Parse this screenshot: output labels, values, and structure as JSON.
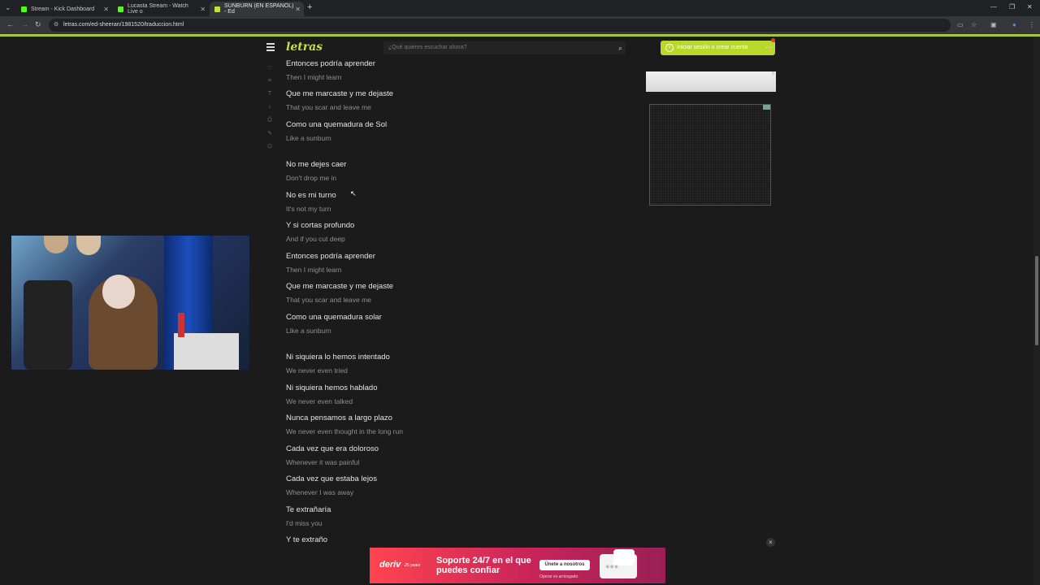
{
  "browser": {
    "tabs": [
      {
        "title": "Stream - Kick Dashboard",
        "favicon_color": "#53fc18"
      },
      {
        "title": "Lucasta Stream - Watch Live o",
        "favicon_color": "#53fc18"
      },
      {
        "title": "SUNBURN (EN ESPAÑOL) - Ed",
        "favicon_color": "#c7e13a"
      }
    ],
    "new_tab": "+",
    "url": "letras.com/ed-sheeran/1981520/traduccion.html"
  },
  "site": {
    "logo": "letras",
    "search_placeholder": "¿Qué quieres escuchar ahora?",
    "login_label": "Iniciar sesión o crear cuenta",
    "more_label": "···"
  },
  "lyrics": [
    {
      "orig": "Entonces podría aprender",
      "trans": "Then I might learn"
    },
    {
      "orig": "Que me marcaste y me dejaste",
      "trans": "That you scar and leave me"
    },
    {
      "orig": "Como una quemadura de Sol",
      "trans": "Like a sunburn"
    },
    {
      "orig": "No me dejes caer",
      "trans": "Don't drop me in"
    },
    {
      "orig": "No es mi turno",
      "trans": "It's not my turn"
    },
    {
      "orig": "Y si cortas profundo",
      "trans": "And if you cut deep"
    },
    {
      "orig": "Entonces podría aprender",
      "trans": "Then I might learn"
    },
    {
      "orig": "Que me marcaste y me dejaste",
      "trans": "That you scar and leave me"
    },
    {
      "orig": "Como una quemadura solar",
      "trans": "Like a sunburn"
    },
    {
      "orig": "Ni siquiera lo hemos intentado",
      "trans": "We never even tried"
    },
    {
      "orig": "Ni siquiera hemos hablado",
      "trans": "We never even talked"
    },
    {
      "orig": "Nunca pensamos a largo plazo",
      "trans": "We never even thought in the long run"
    },
    {
      "orig": "Cada vez que era doloroso",
      "trans": "Whenever it was painful"
    },
    {
      "orig": "Cada vez que estaba lejos",
      "trans": "Whenever I was away"
    },
    {
      "orig": "Te extrañaría",
      "trans": "I'd miss you"
    },
    {
      "orig": "Y te extraño",
      "trans": ""
    }
  ],
  "banner": {
    "brand": "deriv",
    "brand_sub": "25 years",
    "headline": "Soporte 24/7 en el que puedes confiar",
    "cta": "Únete a nosotros",
    "warning": "Operar es arriesgado",
    "close": "×"
  }
}
